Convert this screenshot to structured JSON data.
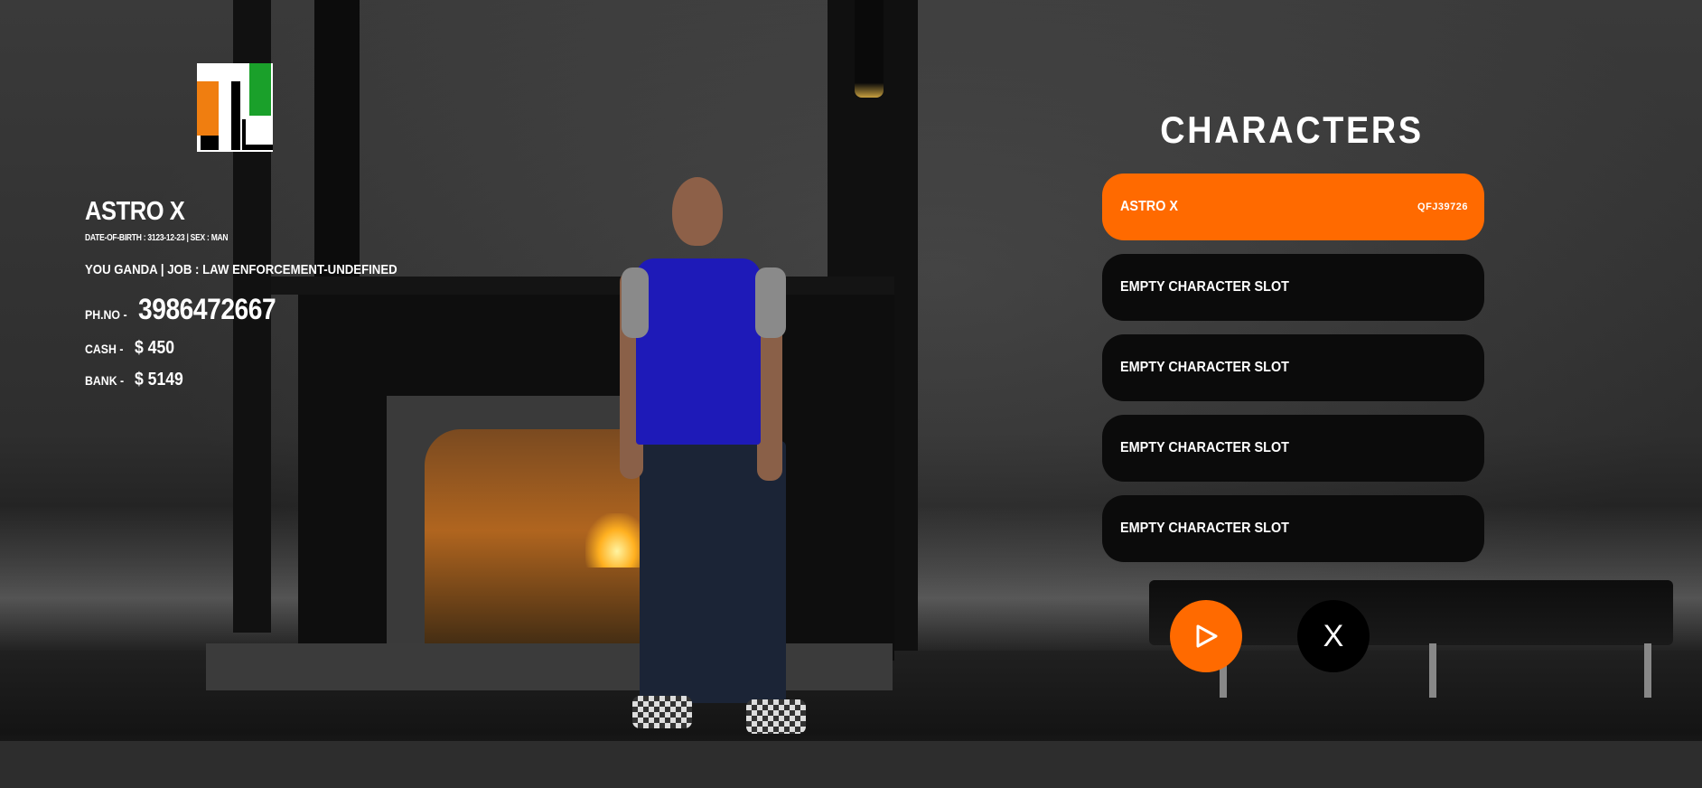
{
  "character_info": {
    "name": "ASTRO X",
    "details": "DATE-OF-BIRTH : 3123-12-23 | SEX : MAN",
    "job": "YOU GANDA | JOB : LAW ENFORCEMENT-UNDEFINED",
    "phone_label": "PH.NO -",
    "phone": "3986472667",
    "cash_label": "CASH -",
    "cash": "$ 450",
    "bank_label": "BANK -",
    "bank": "$ 5149"
  },
  "characters_panel": {
    "title": "CHARACTERS",
    "slots": [
      {
        "name": "ASTRO X",
        "id": "QFJ39726",
        "selected": true
      },
      {
        "name": "EMPTY CHARACTER SLOT",
        "id": ""
      },
      {
        "name": "EMPTY CHARACTER SLOT",
        "id": ""
      },
      {
        "name": "EMPTY CHARACTER SLOT",
        "id": ""
      },
      {
        "name": "EMPTY CHARACTER SLOT",
        "id": ""
      }
    ],
    "close_label": "X",
    "play_icon": "play-icon"
  },
  "colors": {
    "accent": "#ff6a00",
    "slot_bg": "#0b0b0b",
    "close_bg": "#000000"
  },
  "logo": {
    "icon": "tl-logo",
    "letters": "TL"
  }
}
